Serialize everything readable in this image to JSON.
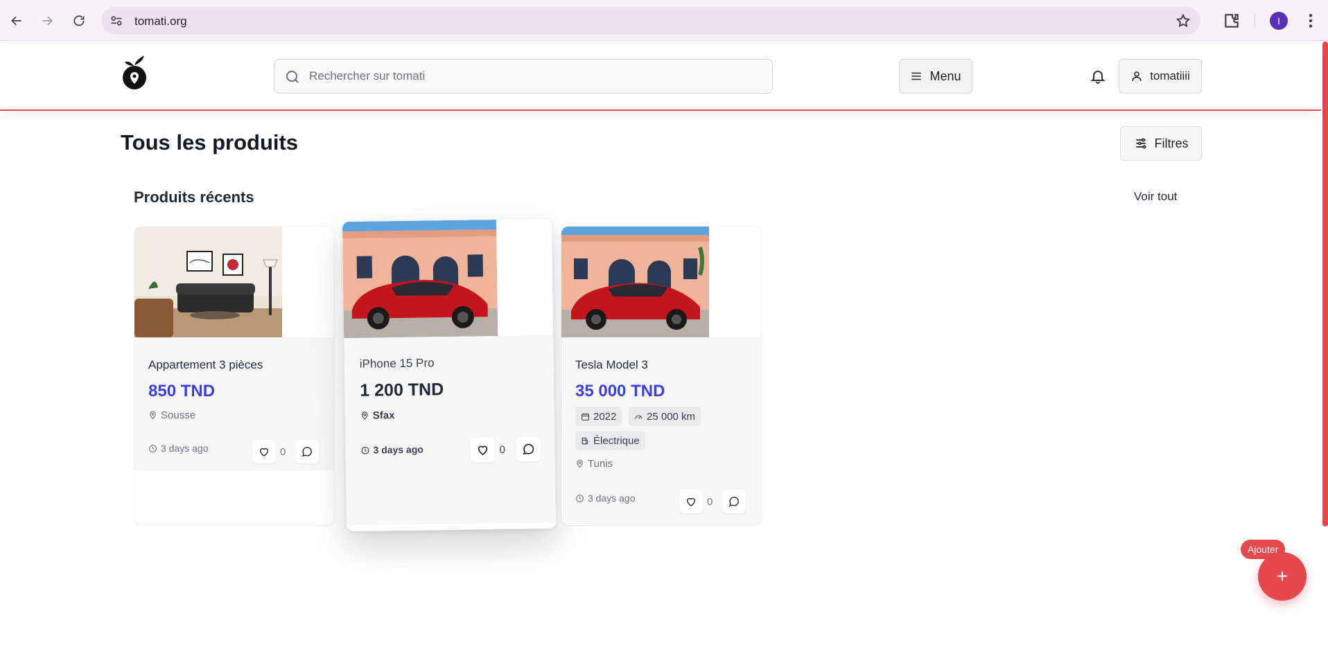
{
  "browser": {
    "url": "tomati.org",
    "profile_initial": "I"
  },
  "header": {
    "search_placeholder": "Rechercher sur tomati",
    "menu_label": "Menu",
    "username": "tomatiiii"
  },
  "page": {
    "title": "Tous les produits",
    "filters_label": "Filtres"
  },
  "section": {
    "title": "Produits récents",
    "see_all": "Voir tout"
  },
  "products": [
    {
      "title": "Appartement 3 pièces",
      "price": "850 TND",
      "location": "Sousse",
      "time": "3 days ago",
      "likes": "0"
    },
    {
      "title": "iPhone 15 Pro",
      "price": "1 200 TND",
      "location": "Sfax",
      "time": "3 days ago",
      "likes": "0"
    },
    {
      "title": "Tesla Model 3",
      "price": "35 000 TND",
      "year": "2022",
      "mileage": "25 000 km",
      "fuel": "Électrique",
      "location": "Tunis",
      "time": "3 days ago",
      "likes": "0"
    }
  ],
  "fab": {
    "label": "Ajouter",
    "icon": "+"
  },
  "colors": {
    "accent": "#e5484d",
    "price": "#3b3fdc"
  }
}
